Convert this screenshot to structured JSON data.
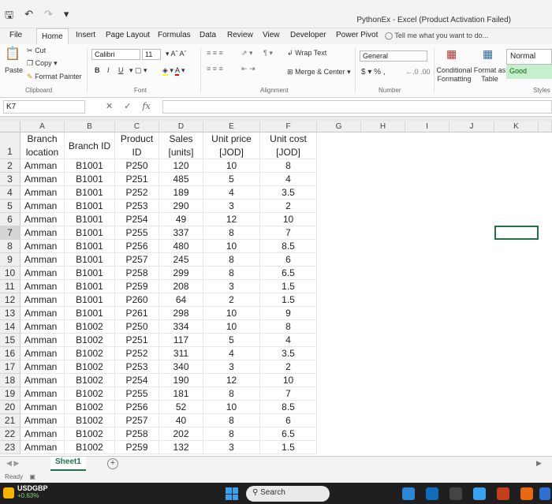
{
  "window": {
    "title": "PythonEx - Excel (Product Activation Failed)",
    "tell_me": "Tell me what you want to do..."
  },
  "menu_tabs": [
    "File",
    "Home",
    "Insert",
    "Page Layout",
    "Formulas",
    "Data",
    "Review",
    "View",
    "Developer",
    "Power Pivot"
  ],
  "ribbon": {
    "cut": "Cut",
    "copy": "Copy",
    "format_painter": "Format Painter",
    "paste": "Paste",
    "clipboard_label": "Clipboard",
    "font_name": "Calibri",
    "font_size": "11",
    "font_label": "Font",
    "wrap_text": "Wrap Text",
    "merge_center": "Merge & Center",
    "alignment_label": "Alignment",
    "number_format": "General",
    "number_label": "Number",
    "conditional_formatting": "Conditional Formatting",
    "format_as_table": "Format as Table",
    "style_normal": "Normal",
    "style_good": "Good",
    "styles_label": "Styles",
    "bold": "B",
    "italic": "I",
    "underline": "U",
    "currency": "$",
    "percent": "%"
  },
  "formula_bar": {
    "name_box": "K7",
    "value": ""
  },
  "columns": [
    "A",
    "B",
    "C",
    "D",
    "E",
    "F",
    "G",
    "H",
    "I",
    "J",
    "K"
  ],
  "header_row": {
    "a1": "Branch location",
    "b1": "Branch ID",
    "c1": "Product ID",
    "d1": "Sales [units]",
    "e1": "Unit price [JOD]",
    "f1": "Unit cost [JOD]"
  },
  "rows": [
    {
      "n": "2",
      "a": "Amman",
      "b": "B1001",
      "c": "P250",
      "d": "120",
      "e": "10",
      "f": "8"
    },
    {
      "n": "3",
      "a": "Amman",
      "b": "B1001",
      "c": "P251",
      "d": "485",
      "e": "5",
      "f": "4"
    },
    {
      "n": "4",
      "a": "Amman",
      "b": "B1001",
      "c": "P252",
      "d": "189",
      "e": "4",
      "f": "3.5"
    },
    {
      "n": "5",
      "a": "Amman",
      "b": "B1001",
      "c": "P253",
      "d": "290",
      "e": "3",
      "f": "2"
    },
    {
      "n": "6",
      "a": "Amman",
      "b": "B1001",
      "c": "P254",
      "d": "49",
      "e": "12",
      "f": "10"
    },
    {
      "n": "7",
      "a": "Amman",
      "b": "B1001",
      "c": "P255",
      "d": "337",
      "e": "8",
      "f": "7"
    },
    {
      "n": "8",
      "a": "Amman",
      "b": "B1001",
      "c": "P256",
      "d": "480",
      "e": "10",
      "f": "8.5"
    },
    {
      "n": "9",
      "a": "Amman",
      "b": "B1001",
      "c": "P257",
      "d": "245",
      "e": "8",
      "f": "6"
    },
    {
      "n": "10",
      "a": "Amman",
      "b": "B1001",
      "c": "P258",
      "d": "299",
      "e": "8",
      "f": "6.5"
    },
    {
      "n": "11",
      "a": "Amman",
      "b": "B1001",
      "c": "P259",
      "d": "208",
      "e": "3",
      "f": "1.5"
    },
    {
      "n": "12",
      "a": "Amman",
      "b": "B1001",
      "c": "P260",
      "d": "64",
      "e": "2",
      "f": "1.5"
    },
    {
      "n": "13",
      "a": "Amman",
      "b": "B1001",
      "c": "P261",
      "d": "298",
      "e": "10",
      "f": "9"
    },
    {
      "n": "14",
      "a": "Amman",
      "b": "B1002",
      "c": "P250",
      "d": "334",
      "e": "10",
      "f": "8"
    },
    {
      "n": "15",
      "a": "Amman",
      "b": "B1002",
      "c": "P251",
      "d": "117",
      "e": "5",
      "f": "4"
    },
    {
      "n": "16",
      "a": "Amman",
      "b": "B1002",
      "c": "P252",
      "d": "311",
      "e": "4",
      "f": "3.5"
    },
    {
      "n": "17",
      "a": "Amman",
      "b": "B1002",
      "c": "P253",
      "d": "340",
      "e": "3",
      "f": "2"
    },
    {
      "n": "18",
      "a": "Amman",
      "b": "B1002",
      "c": "P254",
      "d": "190",
      "e": "12",
      "f": "10"
    },
    {
      "n": "19",
      "a": "Amman",
      "b": "B1002",
      "c": "P255",
      "d": "181",
      "e": "8",
      "f": "7"
    },
    {
      "n": "20",
      "a": "Amman",
      "b": "B1002",
      "c": "P256",
      "d": "52",
      "e": "10",
      "f": "8.5"
    },
    {
      "n": "21",
      "a": "Amman",
      "b": "B1002",
      "c": "P257",
      "d": "40",
      "e": "8",
      "f": "6"
    },
    {
      "n": "22",
      "a": "Amman",
      "b": "B1002",
      "c": "P258",
      "d": "202",
      "e": "8",
      "f": "6.5"
    },
    {
      "n": "23",
      "a": "Amman",
      "b": "B1002",
      "c": "P259",
      "d": "132",
      "e": "3",
      "f": "1.5"
    }
  ],
  "sheet_tabs": [
    "Sheet1"
  ],
  "status": "Ready",
  "taskbar": {
    "ticker_name": "USDGBP",
    "ticker_change": "+0.63%",
    "search_placeholder": "Search"
  },
  "colors": {
    "excel_green": "#217346",
    "good_fill": "#c6efce"
  }
}
